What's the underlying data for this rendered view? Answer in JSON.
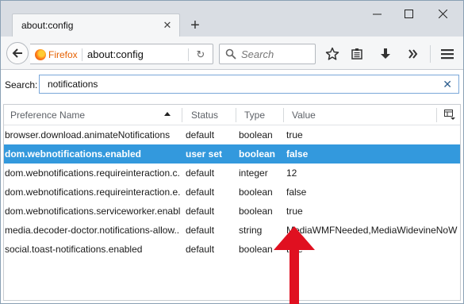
{
  "window": {
    "tab_title": "about:config",
    "accent_color": "#3399dd",
    "annotation_color": "#e01020"
  },
  "navbar": {
    "identity_label": "Firefox",
    "url": "about:config",
    "search_placeholder": "Search"
  },
  "content": {
    "search_label": "Search:",
    "filter_value": "notifications",
    "columns": [
      "Preference Name",
      "Status",
      "Type",
      "Value"
    ],
    "rows": [
      {
        "name": "browser.download.animateNotifications",
        "status": "default",
        "type": "boolean",
        "value": "true",
        "selected": false
      },
      {
        "name": "dom.webnotifications.enabled",
        "status": "user set",
        "type": "boolean",
        "value": "false",
        "selected": true
      },
      {
        "name": "dom.webnotifications.requireinteraction.c...",
        "status": "default",
        "type": "integer",
        "value": "12",
        "selected": false
      },
      {
        "name": "dom.webnotifications.requireinteraction.e...",
        "status": "default",
        "type": "boolean",
        "value": "false",
        "selected": false
      },
      {
        "name": "dom.webnotifications.serviceworker.enabl...",
        "status": "default",
        "type": "boolean",
        "value": "true",
        "selected": false
      },
      {
        "name": "media.decoder-doctor.notifications-allow...",
        "status": "default",
        "type": "string",
        "value": "MediaWMFNeeded,MediaWidevineNoWMF...",
        "selected": false
      },
      {
        "name": "social.toast-notifications.enabled",
        "status": "default",
        "type": "boolean",
        "value": "true",
        "selected": false
      }
    ]
  }
}
